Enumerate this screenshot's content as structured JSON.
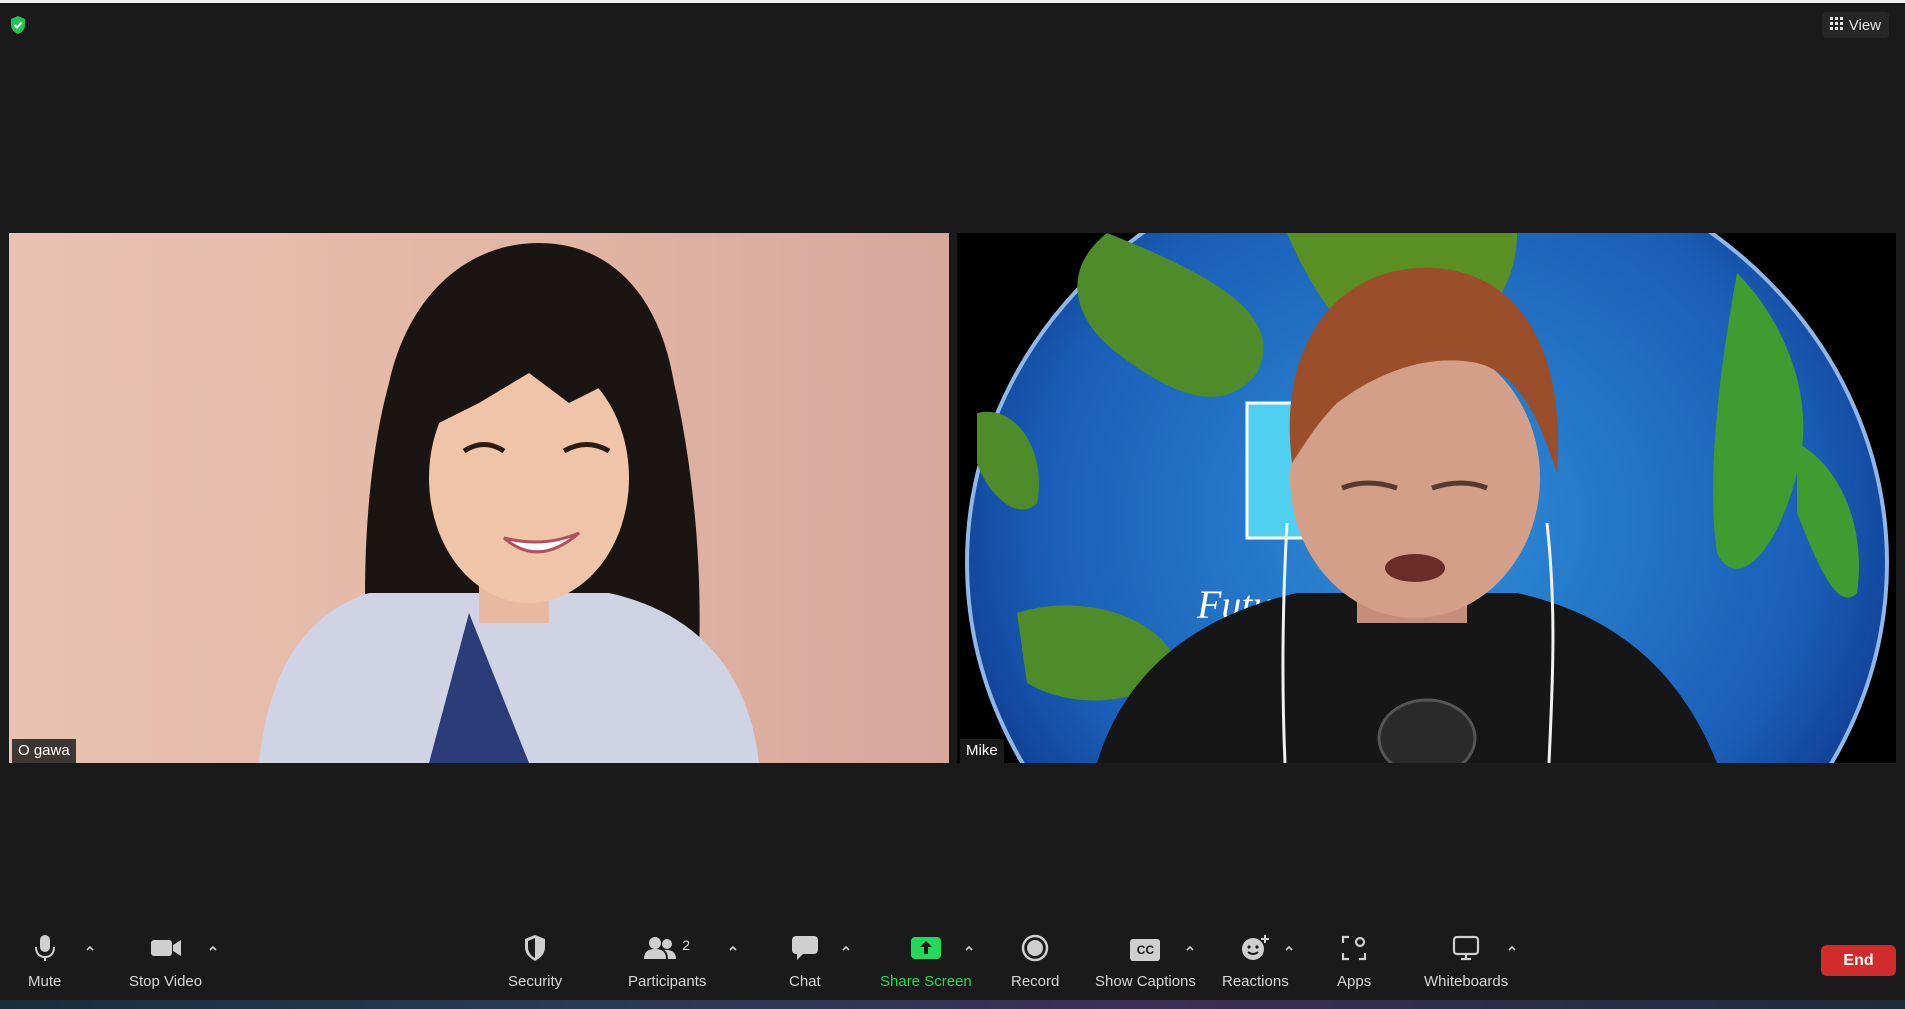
{
  "window": {
    "view_label": "View"
  },
  "participants": [
    {
      "name": "O gawa"
    },
    {
      "name": "Mike"
    }
  ],
  "toolbar": {
    "mute_label": "Mute",
    "stop_video_label": "Stop Video",
    "security_label": "Security",
    "participants_label": "Participants",
    "participants_count": "2",
    "chat_label": "Chat",
    "share_screen_label": "Share Screen",
    "record_label": "Record",
    "show_captions_label": "Show Captions",
    "captions_icon_text": "CC",
    "reactions_label": "Reactions",
    "apps_label": "Apps",
    "whiteboards_label": "Whiteboards",
    "end_label": "End"
  },
  "background_logo_text": "Futu",
  "colors": {
    "background": "#1a1a1a",
    "share_green": "#23d959",
    "end_red": "#d22b2b",
    "security_green": "#23c552"
  },
  "icons": [
    "security-shield-icon",
    "grid-icon",
    "microphone-icon",
    "video-camera-icon",
    "shield-icon",
    "participants-icon",
    "chat-bubble-icon",
    "share-screen-icon",
    "record-icon",
    "captions-icon",
    "reactions-icon",
    "apps-icon",
    "whiteboard-icon"
  ]
}
